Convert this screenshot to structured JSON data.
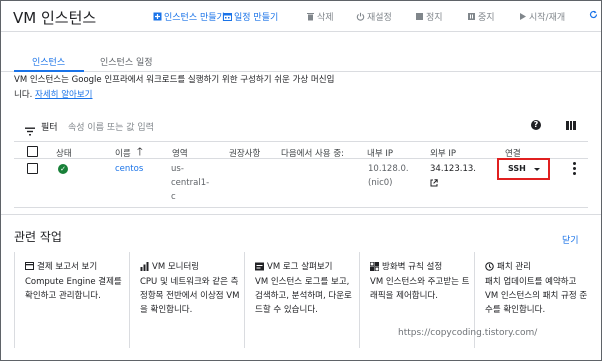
{
  "header": {
    "title": "VM 인스턴스",
    "actions": {
      "create_instance": "인스턴스 만들기",
      "create_schedule": "일정 만들기",
      "delete": "삭제",
      "reset": "재설정",
      "stop": "정지",
      "suspend": "중지",
      "start_resume": "시작/재개"
    }
  },
  "tabs": {
    "instances": "인스턴스",
    "schedules": "인스턴스 일정"
  },
  "description": {
    "text_line1": "VM 인스턴스는 Google 인프라에서 워크로드를 실행하기 위한 구성하기 쉬운 가상 머신입",
    "text_line2": "니다.",
    "learn_more": "자세히 알아보기"
  },
  "filter": {
    "label": "필터",
    "placeholder": "속성 이름 또는 값 입력"
  },
  "table": {
    "headers": {
      "status": "상태",
      "name": "이름",
      "zone": "영역",
      "recommendation": "권장사항",
      "used_by": "다음에서 사용 중:",
      "internal_ip": "내부 IP",
      "external_ip": "외부 IP",
      "connect": "연결"
    },
    "rows": [
      {
        "name": "centos",
        "zone_l1": "us-",
        "zone_l2": "central1-",
        "zone_l3": "c",
        "internal_ip_l1": "10.128.0.",
        "internal_ip_l2": "(nic0)",
        "external_ip": "34.123.13.",
        "connect": "SSH"
      }
    ]
  },
  "related": {
    "title": "관련 작업",
    "hide": "닫기",
    "cards": [
      {
        "icon": "billing-icon",
        "title": "결제 보고서 보기",
        "body": "Compute Engine 결제를 확인하고 관리합니다."
      },
      {
        "icon": "monitoring-icon",
        "title": "VM 모니터링",
        "body": "CPU 및 네트워크와 같은 측정항목 전반에서 이상점 VM을 확인합니다."
      },
      {
        "icon": "logs-icon",
        "title": "VM 로그 살펴보기",
        "body": "VM 인스턴스 로그를 보고, 검색하고, 분석하며, 다운로드할 수 있습니다."
      },
      {
        "icon": "firewall-icon",
        "title": "방화벽 규칙 설정",
        "body": "VM 인스턴스와 주고받는 트래픽을 제어합니다."
      },
      {
        "icon": "patch-icon",
        "title": "패치 관리",
        "body": "패치 업데이트를 예약하고 VM 인스턴스의 패치 규정 준수를 확인합니다."
      }
    ]
  },
  "watermark": "https://copycoding.tistory.com/",
  "colors": {
    "accent": "#1a73e8",
    "running": "#188038",
    "highlight": "#e02020"
  }
}
